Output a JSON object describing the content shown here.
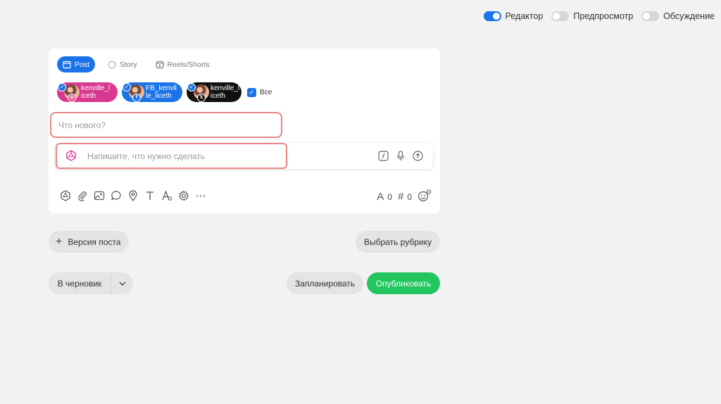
{
  "view_toggles": [
    {
      "label": "Редактор",
      "on": true
    },
    {
      "label": "Предпросмотр",
      "on": false
    },
    {
      "label": "Обсуждение",
      "on": false
    }
  ],
  "tabs": [
    {
      "label": "Post",
      "active": true
    },
    {
      "label": "Story",
      "active": false
    },
    {
      "label": "Reels/Shorts",
      "active": false
    }
  ],
  "accounts": [
    {
      "line1": "kenville_l",
      "line2": "iceth",
      "network": "instagram",
      "color": "#d8398f"
    },
    {
      "line1": "FB_kenvil",
      "line2": "le_liceth",
      "network": "facebook",
      "color": "#1a73e8"
    },
    {
      "line1": "kenville_l",
      "line2": "iceth",
      "network": "x",
      "color": "#111111"
    }
  ],
  "select_all_label": "Все",
  "post_placeholder": "Что нового?",
  "ai_prompt_placeholder": "Напишите, что нужно сделать",
  "counters": {
    "chars": "0",
    "hashtags": "0"
  },
  "buttons": {
    "version": "Версия поста",
    "rubric": "Выбрать рубрику",
    "draft": "В черновик",
    "schedule": "Запланировать",
    "publish": "Опубликовать"
  },
  "colors": {
    "accent": "#1a73e8",
    "publish": "#22c55e",
    "highlight": "#e98585"
  }
}
